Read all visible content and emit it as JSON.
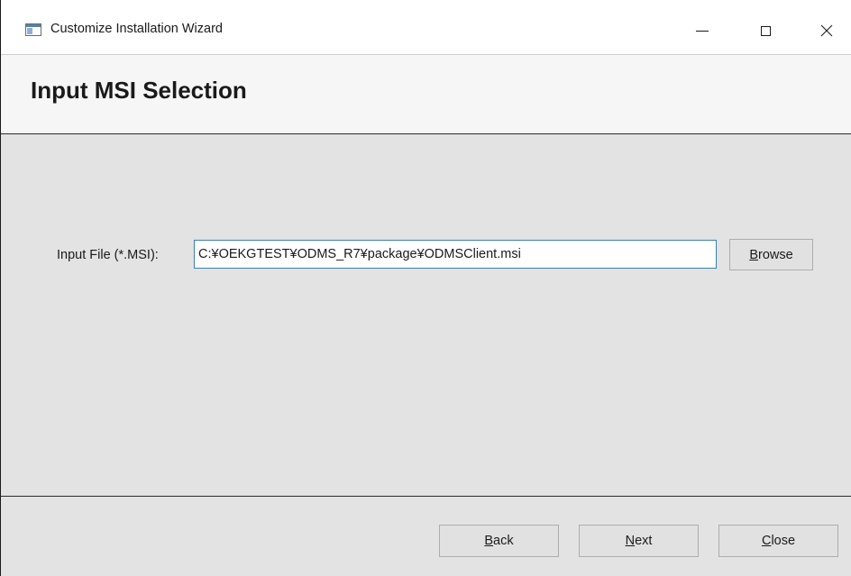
{
  "window": {
    "title": "Customize Installation Wizard"
  },
  "header": {
    "title": "Input MSI Selection"
  },
  "input_file": {
    "label": "Input File (*.MSI):",
    "value": "C:¥OEKGTEST¥ODMS_R7¥package¥ODMSClient.msi"
  },
  "buttons": {
    "browse": {
      "mnemonic": "B",
      "rest": "rowse"
    },
    "back": {
      "mnemonic": "B",
      "rest": "ack"
    },
    "next": {
      "mnemonic": "N",
      "rest": "ext"
    },
    "close": {
      "mnemonic": "C",
      "rest": "lose"
    }
  },
  "caption_icons": {
    "minimize": "minimize-icon",
    "maximize": "maximize-icon",
    "close": "close-icon"
  },
  "colors": {
    "input_focus_border": "#3c7fb1",
    "content_background": "#e3e3e3",
    "header_background": "#f6f6f6"
  }
}
